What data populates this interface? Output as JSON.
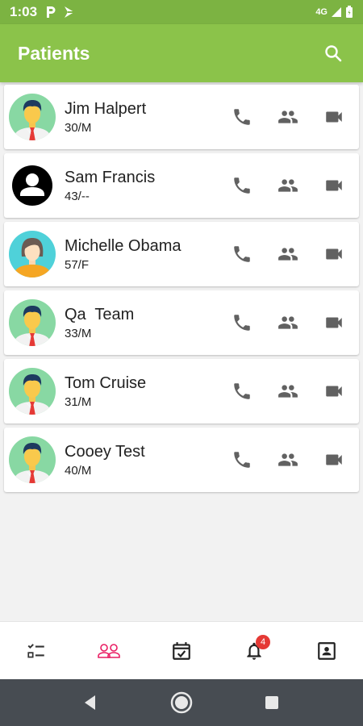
{
  "status_bar": {
    "time": "1:03",
    "network": "4G"
  },
  "app_bar": {
    "title": "Patients"
  },
  "patients": [
    {
      "name": "Jim Halpert",
      "meta": "30/M",
      "avatar": "male-avatar"
    },
    {
      "name": "Sam Francis",
      "meta": "43/--",
      "avatar": "default-user-avatar"
    },
    {
      "name": "Michelle Obama",
      "meta": "57/F",
      "avatar": "female-avatar"
    },
    {
      "name": "Qa  Team",
      "meta": "33/M",
      "avatar": "male-avatar"
    },
    {
      "name": "Tom Cruise",
      "meta": "31/M",
      "avatar": "male-avatar"
    },
    {
      "name": "Cooey Test",
      "meta": "40/M",
      "avatar": "male-avatar"
    }
  ],
  "bottom_nav": {
    "items": [
      {
        "icon": "checklist-icon"
      },
      {
        "icon": "people-outline-icon",
        "active": true
      },
      {
        "icon": "calendar-check-icon"
      },
      {
        "icon": "bell-icon",
        "badge": "4"
      },
      {
        "icon": "contact-card-icon"
      }
    ]
  },
  "colors": {
    "primary": "#8bc34a",
    "status_bar": "#7cb342",
    "accent": "#e91e63",
    "icon_gray": "#616161",
    "badge": "#e53935"
  }
}
